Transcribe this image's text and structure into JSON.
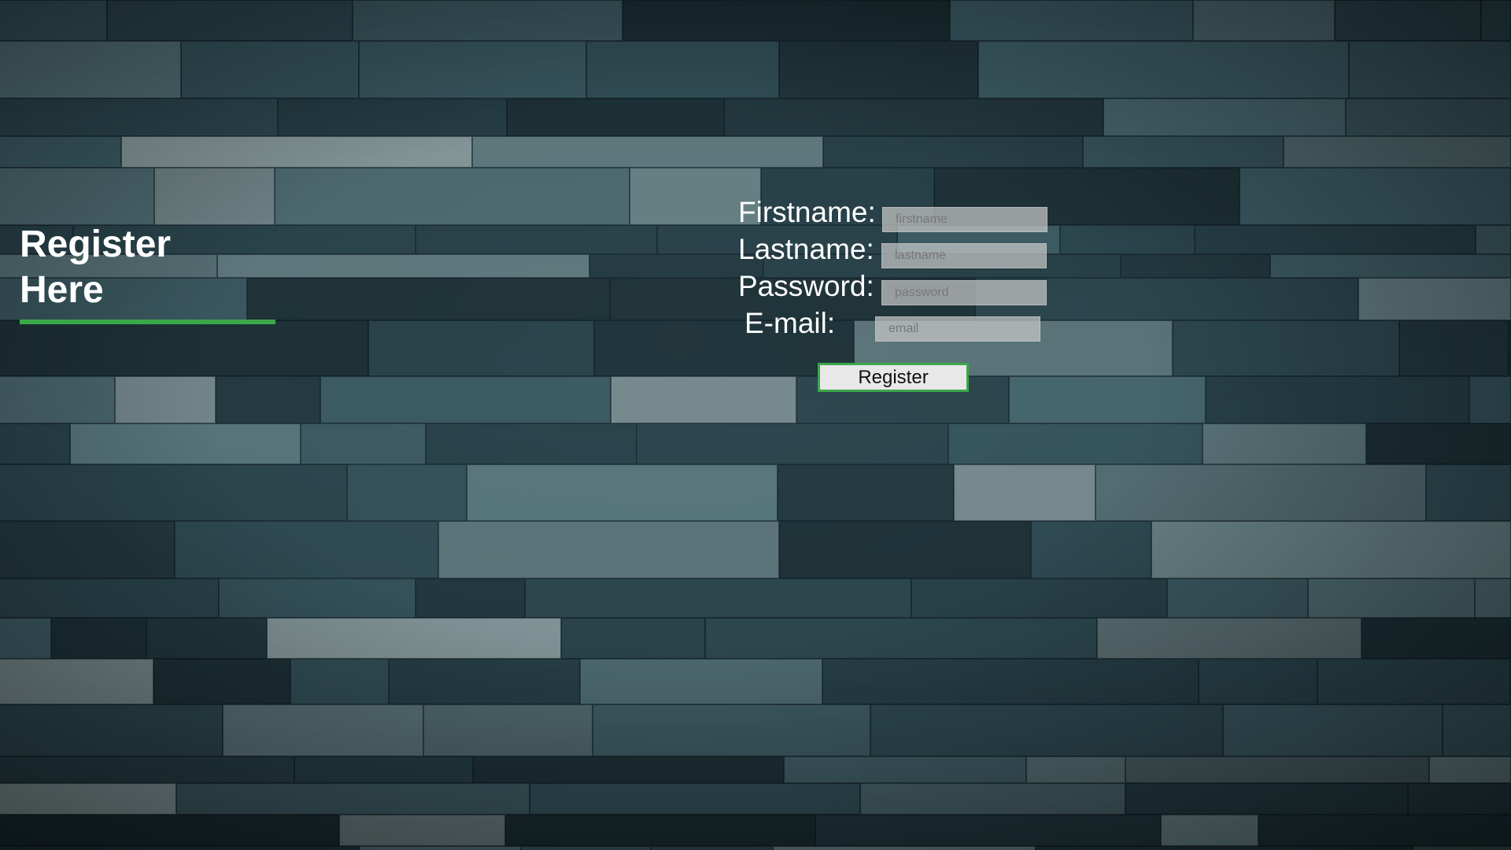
{
  "heading": {
    "line1": "Register",
    "line2": "Here"
  },
  "form": {
    "firstname_label": "Firstname:",
    "firstname_placeholder": "firstname",
    "lastname_label": "Lastname:",
    "lastname_placeholder": "lastname",
    "password_label": "Password:",
    "password_placeholder": "password",
    "email_label": "E-mail:",
    "email_placeholder": "email",
    "submit_label": "Register"
  },
  "colors": {
    "accent": "#3aa84a",
    "text": "#ffffff",
    "background": "#1c3138"
  }
}
